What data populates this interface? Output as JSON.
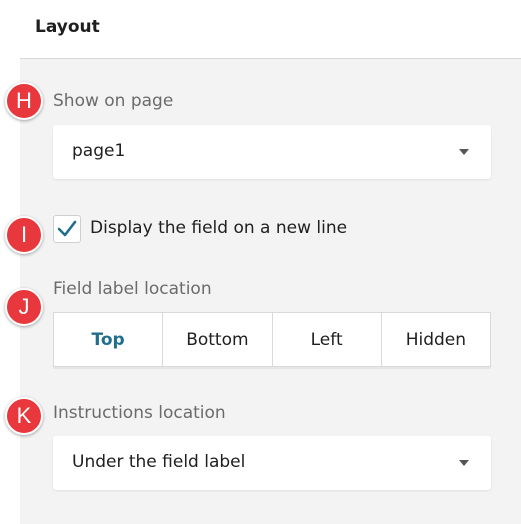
{
  "panel": {
    "title": "Layout"
  },
  "markers": [
    "H",
    "I",
    "J",
    "K"
  ],
  "show_on_page": {
    "label": "Show on page",
    "value": "page1"
  },
  "new_line_checkbox": {
    "label": "Display the field on a new line",
    "checked": true
  },
  "field_label_location": {
    "label": "Field label location",
    "options": [
      "Top",
      "Bottom",
      "Left",
      "Hidden"
    ],
    "selected": "Top"
  },
  "instructions_location": {
    "label": "Instructions location",
    "value": "Under the field label"
  },
  "colors": {
    "marker": "#e8383d",
    "accent": "#1f6e8c",
    "panel_bg": "#f3f3f3"
  }
}
